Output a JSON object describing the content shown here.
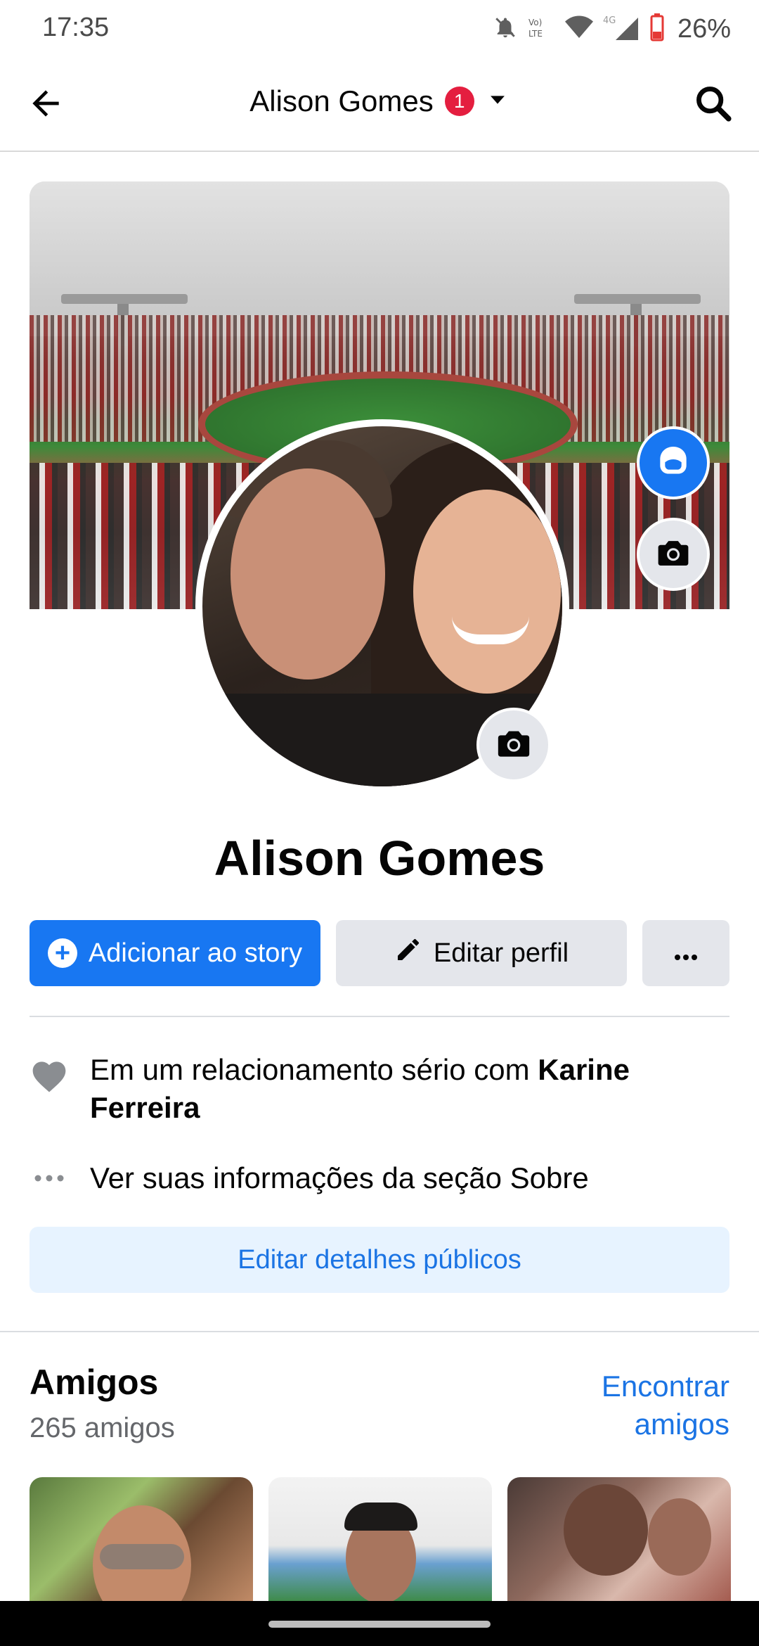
{
  "status_bar": {
    "time": "17:35",
    "battery": "26%",
    "icons": [
      "bell-off-icon",
      "volte-icon",
      "wifi-icon",
      "signal-4g-icon",
      "battery-icon"
    ]
  },
  "header": {
    "title": "Alison Gomes",
    "badge_count": "1",
    "icons": [
      "back-arrow-icon",
      "dropdown-caret-icon",
      "search-icon"
    ]
  },
  "profile": {
    "name": "Alison Gomes"
  },
  "actions": {
    "add_story": "Adicionar ao story",
    "edit_profile": "Editar perfil",
    "more": "···"
  },
  "info": {
    "relationship_prefix": "Em um relacionamento sério com ",
    "relationship_partner": "Karine Ferreira",
    "about_link": "Ver suas informações da seção Sobre"
  },
  "edit_public_details": "Editar detalhes públicos",
  "friends": {
    "title": "Amigos",
    "count": "265 amigos",
    "find_friends": "Encontrar amigos"
  },
  "colors": {
    "primary": "#1877f2",
    "link": "#1b74e4",
    "badge": "#e41e3f",
    "secondary_button": "#e4e6eb",
    "light_blue_button": "#e7f3ff"
  }
}
